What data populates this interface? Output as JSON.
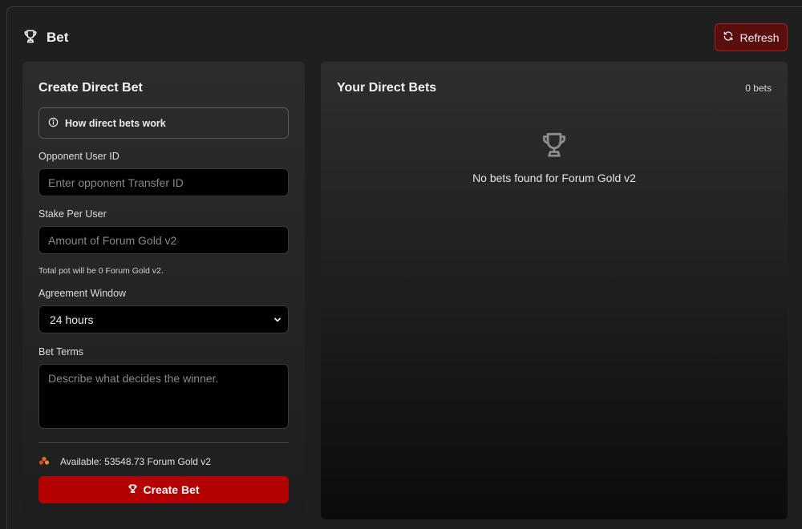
{
  "header": {
    "title": "Bet",
    "refresh_label": "Refresh"
  },
  "create_panel": {
    "title": "Create Direct Bet",
    "info_label": "How direct bets work",
    "opponent": {
      "label": "Opponent User ID",
      "placeholder": "Enter opponent Transfer ID",
      "value": ""
    },
    "stake": {
      "label": "Stake Per User",
      "placeholder": "Amount of Forum Gold v2",
      "value": ""
    },
    "pot_hint": "Total pot will be 0 Forum Gold v2.",
    "window": {
      "label": "Agreement Window",
      "selected": "24 hours"
    },
    "terms": {
      "label": "Bet Terms",
      "placeholder": "Describe what decides the winner.",
      "value": ""
    },
    "available_text": "Available: 53548.73 Forum Gold v2",
    "submit_label": "Create Bet"
  },
  "bets_panel": {
    "title": "Your Direct Bets",
    "count": "0 bets",
    "empty_text": "No bets found for Forum Gold v2"
  },
  "colors": {
    "accent": "#b30000",
    "refresh_bg": "#5a0e0e",
    "refresh_border": "#a12424",
    "coin": "#e0662a"
  },
  "icons": {
    "header": "trophy-icon",
    "refresh": "refresh-icon",
    "info": "info-circle-icon",
    "select": "chevron-down-icon",
    "available": "coins-icon",
    "submit": "trophy-icon",
    "empty": "trophy-icon"
  }
}
